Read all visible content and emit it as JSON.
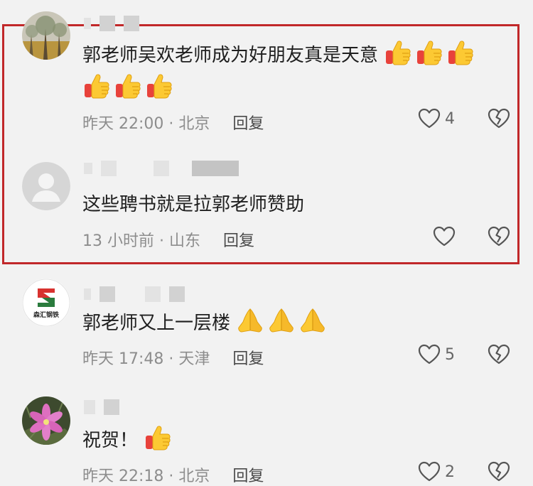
{
  "comments": [
    {
      "text": "郭老师吴欢老师成为好朋友真是天意",
      "emoji": "thumbs-up",
      "emoji_count": 6,
      "time": "昨天 22:00",
      "location": "北京",
      "reply_label": "回复",
      "likes": "4",
      "highlighted": true
    },
    {
      "text": "这些聘书就是拉郭老师赞助",
      "emoji": "",
      "emoji_count": 0,
      "time": "13 小时前",
      "location": "山东",
      "reply_label": "回复",
      "likes": "",
      "highlighted": true
    },
    {
      "text": "郭老师又上一层楼",
      "emoji": "praying-hands",
      "emoji_count": 3,
      "time": "昨天 17:48",
      "location": "天津",
      "reply_label": "回复",
      "likes": "5",
      "highlighted": false
    },
    {
      "text": "祝贺！",
      "emoji": "thumbs-up",
      "emoji_count": 1,
      "time": "昨天 22:18",
      "location": "北京",
      "reply_label": "回复",
      "likes": "2",
      "highlighted": false
    }
  ],
  "avatar_logo_text": "森汇钢铁",
  "separator": " · ",
  "colors": {
    "background": "#f2f2f2",
    "highlight_border": "#c1282a",
    "meta_text": "#8d8d8d",
    "icon_stroke": "#555555"
  }
}
